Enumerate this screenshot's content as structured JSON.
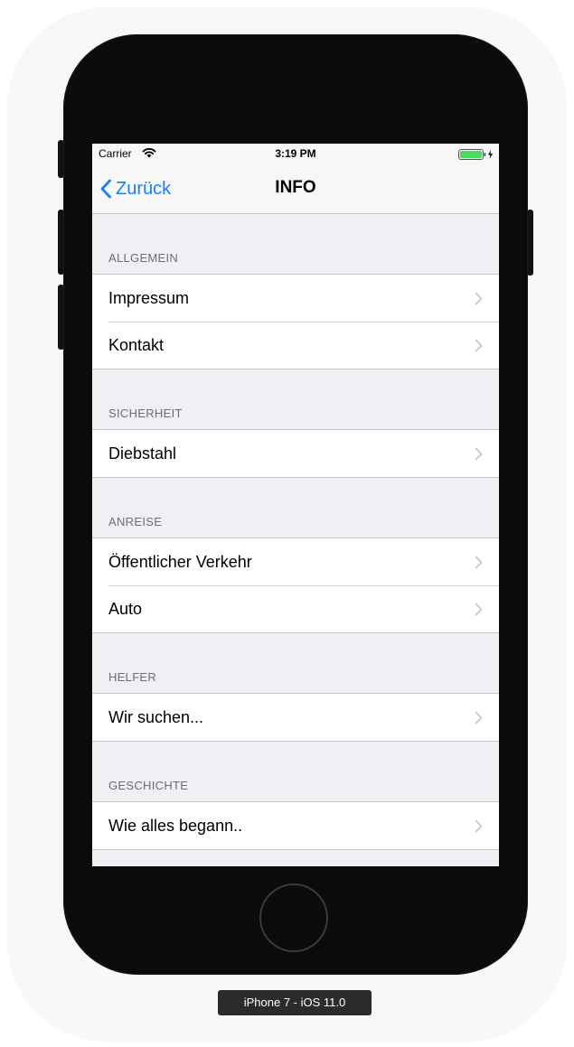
{
  "status_bar": {
    "carrier": "Carrier",
    "time": "3:19 PM",
    "wifi_icon": "wifi-icon",
    "battery_icon": "battery-charging-icon"
  },
  "nav_bar": {
    "back_label": "Zurück",
    "back_icon": "chevron-left-icon",
    "title": "INFO"
  },
  "sections": [
    {
      "header": "ALLGEMEIN",
      "items": [
        {
          "label": "Impressum"
        },
        {
          "label": "Kontakt"
        }
      ]
    },
    {
      "header": "SICHERHEIT",
      "items": [
        {
          "label": "Diebstahl"
        }
      ]
    },
    {
      "header": "ANREISE",
      "items": [
        {
          "label": "Öffentlicher Verkehr"
        },
        {
          "label": "Auto"
        }
      ]
    },
    {
      "header": "HELFER",
      "items": [
        {
          "label": "Wir suchen..."
        }
      ]
    },
    {
      "header": "GESCHICHTE",
      "items": [
        {
          "label": "Wie alles begann.."
        }
      ]
    }
  ],
  "device_label": "iPhone 7 - iOS 11.0",
  "colors": {
    "accent": "#1a7ff5",
    "background": "#efeff4",
    "section_header_text": "#6d6d72",
    "battery": "#4cd964"
  }
}
